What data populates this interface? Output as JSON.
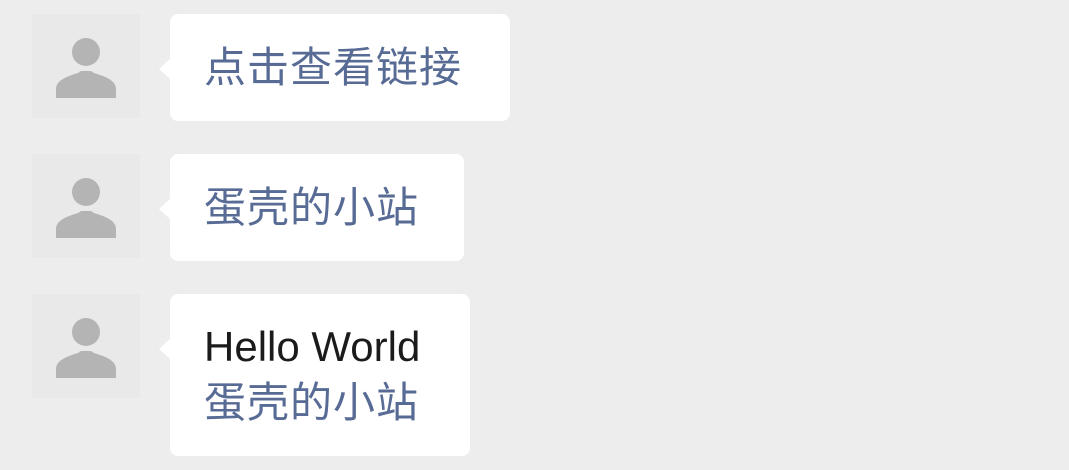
{
  "messages": [
    {
      "link_text": "点击查看链接"
    },
    {
      "link_text": "蛋壳的小站"
    },
    {
      "plain_text": "Hello World",
      "link_text": "蛋壳的小站"
    }
  ],
  "colors": {
    "background": "#ededed",
    "bubble": "#ffffff",
    "link": "#576b95",
    "text": "#1b1b1b",
    "avatar_icon": "#b4b4b4"
  },
  "icons": {
    "avatar": "default-user-icon"
  }
}
